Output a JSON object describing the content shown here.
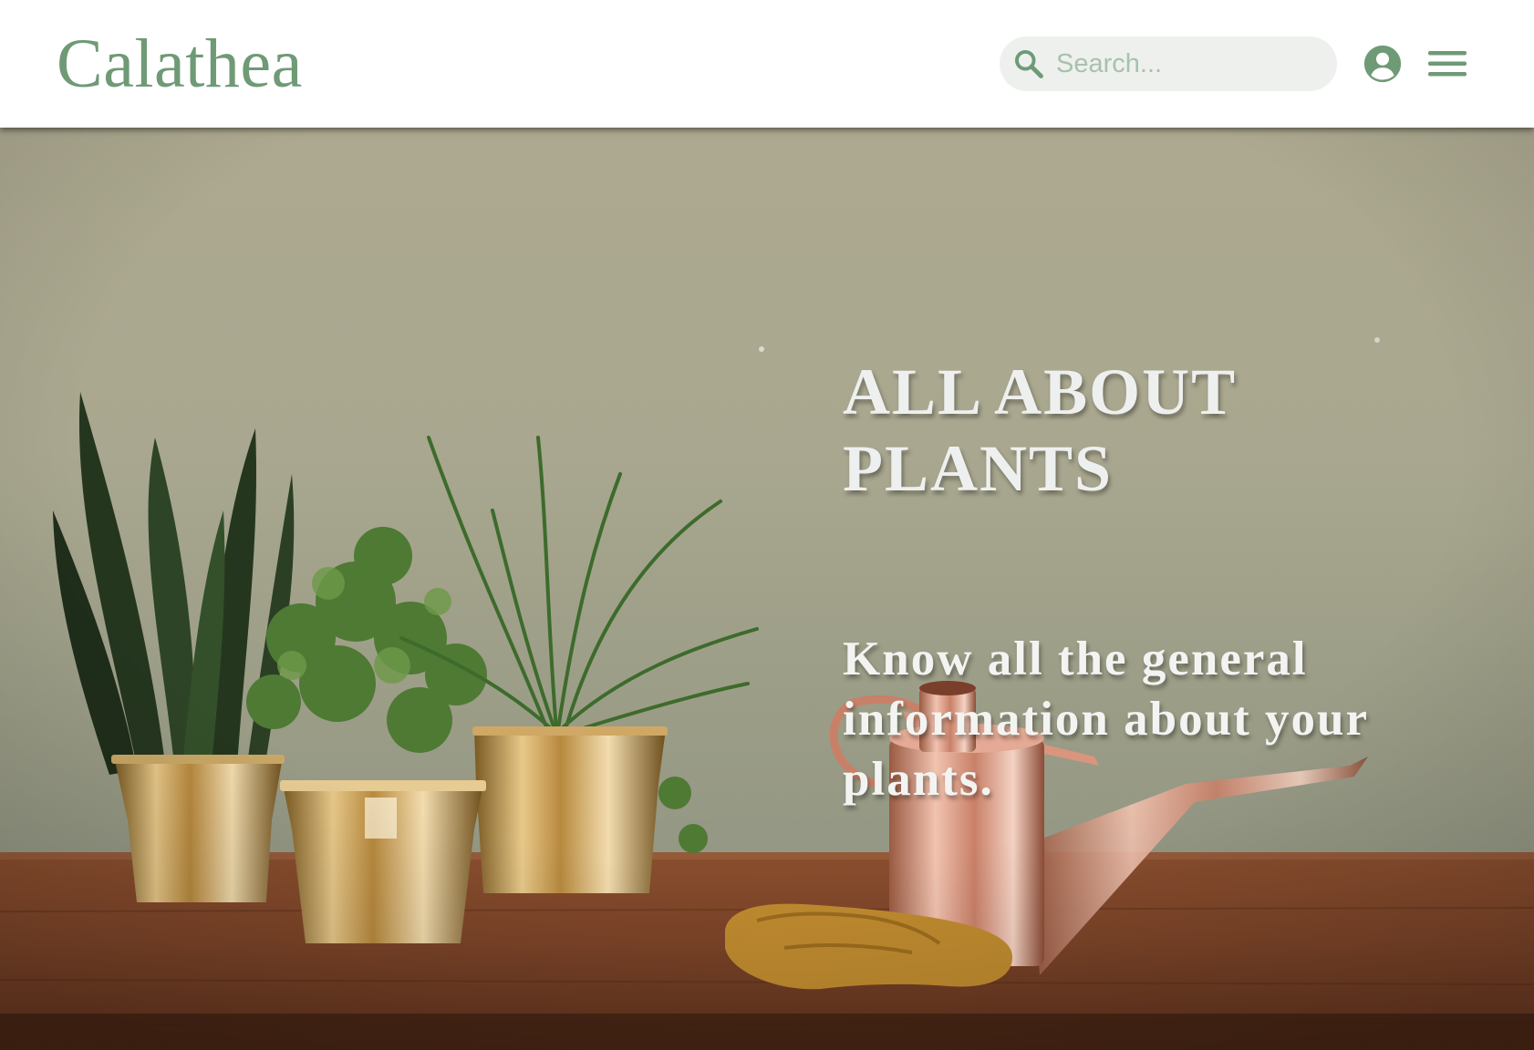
{
  "header": {
    "logo": "Calathea",
    "search": {
      "placeholder": "Search...",
      "value": ""
    },
    "icons": {
      "search": "search-icon",
      "account": "account-circle-icon",
      "menu": "hamburger-menu-icon"
    }
  },
  "hero": {
    "title_lines": [
      "ALL ABOUT",
      "PLANTS"
    ],
    "subtitle_lines": [
      "Know all the general",
      "information about your",
      "plants."
    ]
  },
  "colors": {
    "brand_green": "#6f9a76",
    "search_bg": "#eef0ee",
    "placeholder": "#a7c2aa",
    "hero_wall": "#a9a78f",
    "hero_text": "#eef0ef",
    "table_wood": "#7a4325"
  }
}
